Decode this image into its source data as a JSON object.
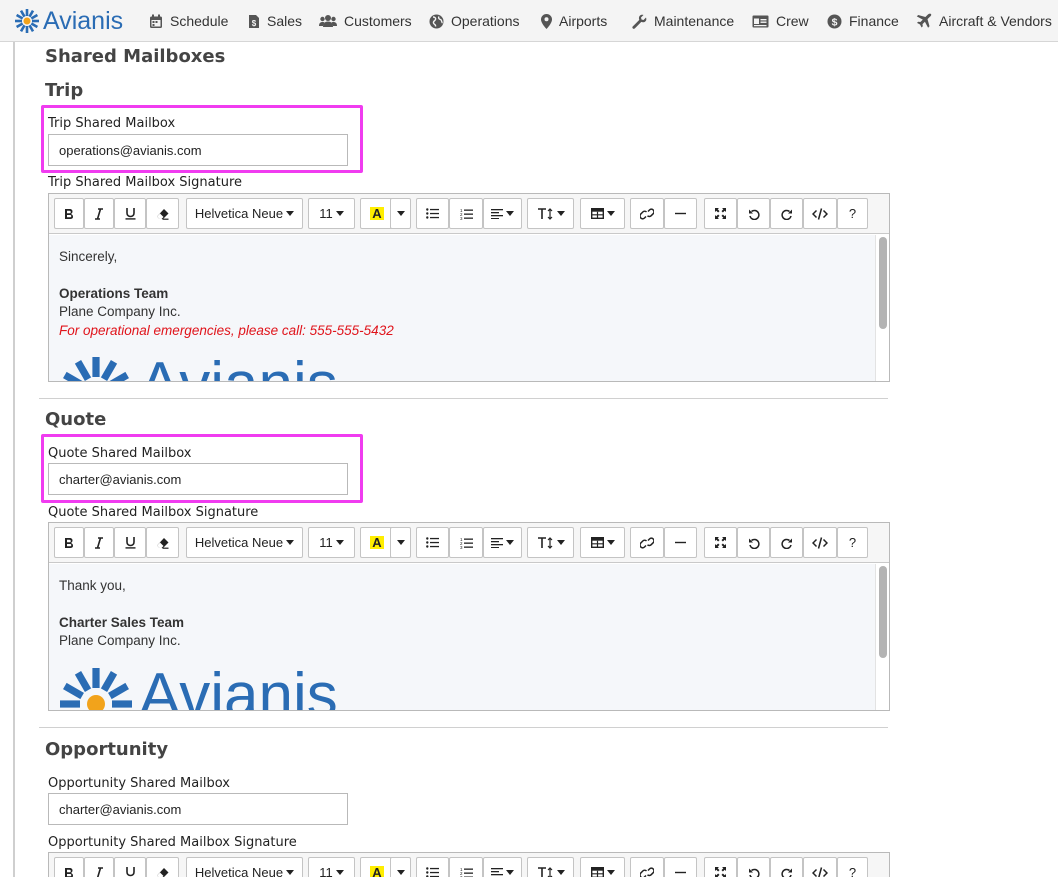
{
  "nav": {
    "brand": "Avianis",
    "items": [
      {
        "label": "Schedule",
        "icon": "calendar-icon"
      },
      {
        "label": "Sales",
        "icon": "dollar-doc-icon"
      },
      {
        "label": "Customers",
        "icon": "users-icon"
      },
      {
        "label": "Operations",
        "icon": "globe-icon"
      },
      {
        "label": "Airports",
        "icon": "map-pin-icon"
      },
      {
        "label": "Maintenance",
        "icon": "wrench-icon"
      },
      {
        "label": "Crew",
        "icon": "id-card-icon"
      },
      {
        "label": "Finance",
        "icon": "dollar-circle-icon"
      },
      {
        "label": "Aircraft & Vendors",
        "icon": "plane-icon"
      }
    ]
  },
  "page": {
    "title": "Shared Mailboxes"
  },
  "toolbar": {
    "font_name": "Helvetica Neue",
    "font_size": "11",
    "text_color_label": "A",
    "highlight_color": "#ffee00",
    "help_label": "?"
  },
  "sections": [
    {
      "heading": "Trip",
      "mailbox_label": "Trip Shared Mailbox",
      "mailbox_value": "operations@avianis.com",
      "signature_label": "Trip Shared Mailbox Signature",
      "signature": {
        "greeting": "Sincerely,",
        "team": "Operations Team",
        "company": "Plane Company Inc.",
        "note": "For operational emergencies, please call: 555-555-5432",
        "logo_text": "Avianis"
      }
    },
    {
      "heading": "Quote",
      "mailbox_label": "Quote Shared Mailbox",
      "mailbox_value": "charter@avianis.com",
      "signature_label": "Quote Shared Mailbox Signature",
      "signature": {
        "greeting": "Thank you,",
        "team": "Charter Sales Team",
        "company": "Plane Company Inc.",
        "logo_text": "Avianis"
      }
    },
    {
      "heading": "Opportunity",
      "mailbox_label": "Opportunity Shared Mailbox",
      "mailbox_value": "charter@avianis.com",
      "signature_label": "Opportunity Shared Mailbox Signature"
    }
  ],
  "colors": {
    "brand": "#2a6cb4",
    "highlight_box": "#f03cf0",
    "emergency_note": "#e0141b"
  }
}
